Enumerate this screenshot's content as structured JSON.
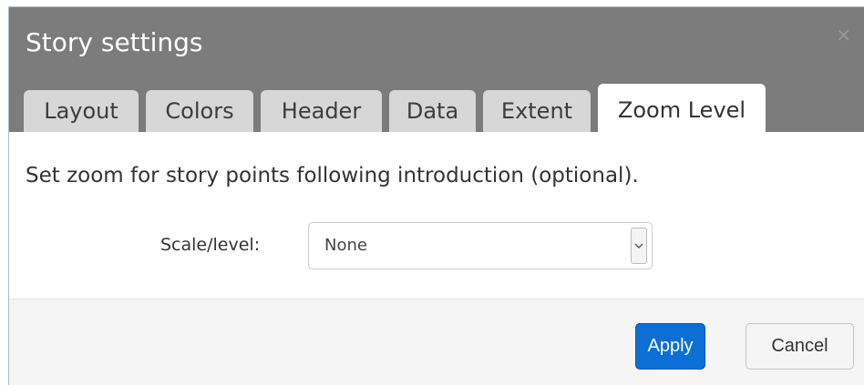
{
  "dialog": {
    "title": "Story settings",
    "close_glyph": "×"
  },
  "tabs": [
    {
      "label": "Layout",
      "active": false
    },
    {
      "label": "Colors",
      "active": false
    },
    {
      "label": "Header",
      "active": false
    },
    {
      "label": "Data",
      "active": false
    },
    {
      "label": "Extent",
      "active": false
    },
    {
      "label": "Zoom Level",
      "active": true
    }
  ],
  "content": {
    "description": "Set zoom for story points following introduction (optional).",
    "scale_label": "Scale/level:",
    "scale_value": "None"
  },
  "footer": {
    "apply_label": "Apply",
    "cancel_label": "Cancel"
  },
  "colors": {
    "header_bg": "#7c7c7c",
    "primary_button": "#0b6fd6"
  }
}
